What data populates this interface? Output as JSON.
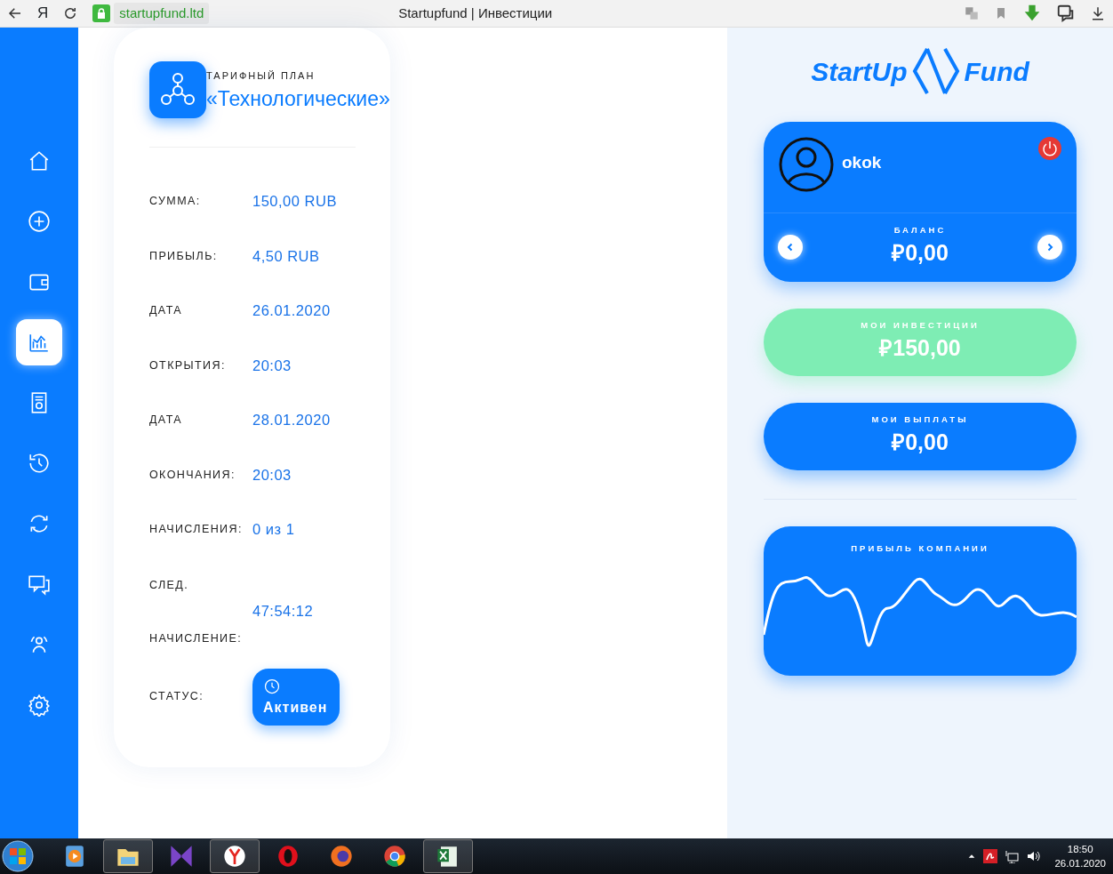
{
  "browser": {
    "app_letter": "Я",
    "url": "startupfund.ltd",
    "title": "Startupfund | Инвестиции"
  },
  "sidebar": {
    "items": [
      {
        "kind": "home",
        "selected": false
      },
      {
        "kind": "plus",
        "selected": false
      },
      {
        "kind": "wallet",
        "selected": false
      },
      {
        "kind": "chart",
        "selected": true
      },
      {
        "kind": "document",
        "selected": false
      },
      {
        "kind": "history",
        "selected": false
      },
      {
        "kind": "refresh",
        "selected": false
      },
      {
        "kind": "chat",
        "selected": false
      },
      {
        "kind": "team",
        "selected": false
      },
      {
        "kind": "gear",
        "selected": false
      }
    ]
  },
  "plan": {
    "caption": "ТАРИФНЫЙ ПЛАН",
    "name": "«Технологические»",
    "details": [
      {
        "label": "СУММА:",
        "value": "150,00 RUB"
      },
      {
        "label": "ПРИБЫЛЬ:",
        "value": "4,50 RUB"
      },
      {
        "label": "ДАТА",
        "value": "26.01.2020"
      },
      {
        "label": "ОТКРЫТИЯ:",
        "value": "20:03"
      },
      {
        "label": "ДАТА",
        "value": "28.01.2020"
      },
      {
        "label": "ОКОНЧАНИЯ:",
        "value": "20:03"
      },
      {
        "label": "НАЧИСЛЕНИЯ:",
        "value": "0 из 1"
      },
      {
        "label": "СЛЕД. НАЧИСЛЕНИЕ:",
        "value": "47:54:12"
      }
    ],
    "status_label": "СТАТУС:",
    "status": "Активен"
  },
  "logo": {
    "left": "StartUp",
    "right": "Fund"
  },
  "profile": {
    "username": "okok",
    "balance_label": "БАЛАНС",
    "balance": "₽0,00"
  },
  "stats": [
    {
      "label": "МОИ ИНВЕСТИЦИИ",
      "value": "₽150,00",
      "color": "#7eedb4"
    },
    {
      "label": "МОИ ВЫПЛАТЫ",
      "value": "₽0,00",
      "color": "#0a7cff"
    }
  ],
  "profit_chart": {
    "title": "ПРИБЫЛЬ КОМПАНИИ"
  },
  "taskbar": {
    "apps": [
      {
        "kind": "media",
        "open": false
      },
      {
        "kind": "folder",
        "open": true
      },
      {
        "kind": "player",
        "open": false
      },
      {
        "kind": "yandex",
        "open": true
      },
      {
        "kind": "opera",
        "open": false
      },
      {
        "kind": "firefox",
        "open": false
      },
      {
        "kind": "chrome",
        "open": false
      },
      {
        "kind": "excel",
        "open": true
      }
    ],
    "time": "18:50",
    "date": "26.01.2020"
  }
}
